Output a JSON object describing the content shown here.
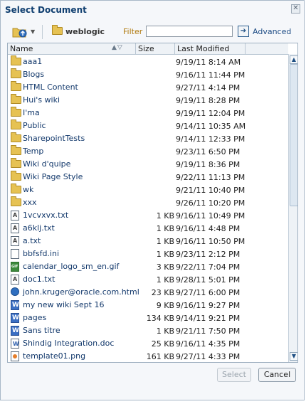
{
  "dialog": {
    "title": "Select Document"
  },
  "toolbar": {
    "current_folder": "weblogic",
    "filter_label": "Filter",
    "filter_value": "",
    "advanced_label": "Advanced"
  },
  "columns": {
    "name": "Name",
    "size": "Size",
    "modified": "Last Modified"
  },
  "files": [
    {
      "icon": "folder-icon",
      "name": "aaa1",
      "size": "",
      "modified": "9/19/11 8:14 AM"
    },
    {
      "icon": "folder-icon",
      "name": "Blogs",
      "size": "",
      "modified": "9/16/11 11:44 PM"
    },
    {
      "icon": "folder-icon",
      "name": "HTML Content",
      "size": "",
      "modified": "9/27/11 4:14 PM"
    },
    {
      "icon": "folder-icon",
      "name": "Hui's wiki",
      "size": "",
      "modified": "9/19/11 8:28 PM"
    },
    {
      "icon": "folder-icon",
      "name": "I'ma",
      "size": "",
      "modified": "9/19/11 12:04 PM"
    },
    {
      "icon": "folder-icon",
      "name": "Public",
      "size": "",
      "modified": "9/14/11 10:35 AM"
    },
    {
      "icon": "folder-icon",
      "name": "SharepointTests",
      "size": "",
      "modified": "9/14/11 12:33 PM"
    },
    {
      "icon": "folder-icon",
      "name": "Temp",
      "size": "",
      "modified": "9/23/11 6:50 PM"
    },
    {
      "icon": "folder-icon",
      "name": "Wiki d'quipe",
      "size": "",
      "modified": "9/19/11 8:36 PM"
    },
    {
      "icon": "folder-icon",
      "name": "Wiki Page Style",
      "size": "",
      "modified": "9/22/11 11:13 PM"
    },
    {
      "icon": "folder-icon",
      "name": "wk",
      "size": "",
      "modified": "9/21/11 10:40 PM"
    },
    {
      "icon": "folder-icon",
      "name": "xxx",
      "size": "",
      "modified": "9/26/11 10:20 PM"
    },
    {
      "icon": "text-file-icon",
      "name": "1vcvxvx.txt",
      "size": "1 KB",
      "modified": "9/16/11 10:49 PM"
    },
    {
      "icon": "text-file-icon",
      "name": "a6klj.txt",
      "size": "1 KB",
      "modified": "9/16/11 4:48 PM"
    },
    {
      "icon": "text-file-icon",
      "name": "a.txt",
      "size": "1 KB",
      "modified": "9/16/11 10:50 PM"
    },
    {
      "icon": "ini-file-icon",
      "name": "bbfsfd.ini",
      "size": "1 KB",
      "modified": "9/23/11 2:12 PM"
    },
    {
      "icon": "gif-file-icon",
      "name": "calendar_logo_sm_en.gif",
      "size": "3 KB",
      "modified": "9/22/11 7:04 PM"
    },
    {
      "icon": "text-file-icon",
      "name": "doc1.txt",
      "size": "1 KB",
      "modified": "9/28/11 5:01 PM"
    },
    {
      "icon": "html-file-icon",
      "name": "john.kruger@oracle.com.html",
      "size": "23 KB",
      "modified": "9/27/11 6:00 PM"
    },
    {
      "icon": "wiki-file-icon",
      "name": "my new wiki Sept 16",
      "size": "9 KB",
      "modified": "9/16/11 9:27 PM"
    },
    {
      "icon": "wiki-file-icon",
      "name": "pages",
      "size": "134 KB",
      "modified": "9/14/11 9:21 PM"
    },
    {
      "icon": "wiki-file-icon",
      "name": "Sans titre",
      "size": "1 KB",
      "modified": "9/21/11 7:50 PM"
    },
    {
      "icon": "word-doc-icon",
      "name": "Shindig Integration.doc",
      "size": "25 KB",
      "modified": "9/16/11 4:35 PM"
    },
    {
      "icon": "png-file-icon",
      "name": "template01.png",
      "size": "161 KB",
      "modified": "9/27/11 4:33 PM"
    }
  ],
  "buttons": {
    "select": "Select",
    "cancel": "Cancel"
  }
}
